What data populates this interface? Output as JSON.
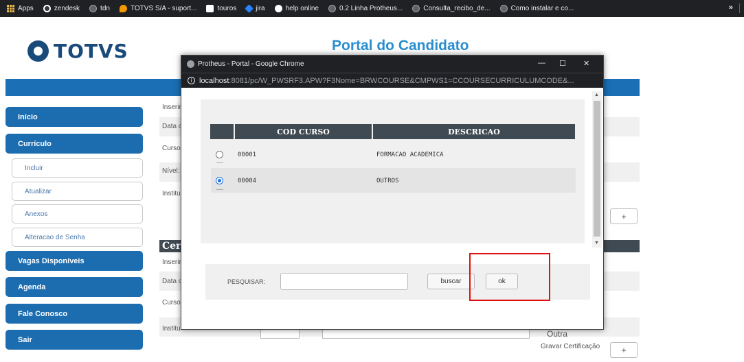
{
  "bookmarks": {
    "items": [
      "Apps",
      "zendesk",
      "tdn",
      "TOTVS S/A - suport...",
      "touros",
      "jira",
      "help online",
      "0.2 Linha Protheus...",
      "Consulta_recibo_de...",
      "Como instalar e co..."
    ],
    "more": "»"
  },
  "header": {
    "logo": "TOTVS",
    "title": "Portal do Candidato"
  },
  "sidebar": {
    "items": [
      "Início",
      "Currículo",
      "Incluir",
      "Atualizar",
      "Anexos",
      "Alteracao de Senha",
      "Vagas Disponíveis",
      "Agenda",
      "Fale Conosco",
      "Sair"
    ]
  },
  "background_form": {
    "labels": [
      "Inserir",
      "Data d",
      "Curso",
      "Nível:",
      "Institu",
      "Inserir",
      "Data d",
      "Curso",
      "Institu"
    ],
    "section": "Cer",
    "plus": "+",
    "outra": "Outra",
    "gravar": "Gravar Certificação"
  },
  "popup": {
    "title": "Protheus - Portal - Google Chrome",
    "url_host": "localhost",
    "url_rest": ":8081/pc/W_PWSRF3.APW?F3Nome=BRWCOURSE&CMPWS1=CCOURSECURRICULUMCODE&...",
    "controls": {
      "minimize": "—",
      "maximize": "☐",
      "close": "✕"
    },
    "grid": {
      "columns": [
        "COD CURSO",
        "DESCRICAO"
      ],
      "rows": [
        {
          "code": "00001",
          "desc": "FORMACAO ACADEMICA",
          "selected": false
        },
        {
          "code": "00004",
          "desc": "OUTROS",
          "selected": true
        }
      ]
    },
    "search": {
      "label": "PESQUISAR:",
      "value": "",
      "buscar": "buscar",
      "ok": "ok"
    }
  },
  "colors": {
    "brand_blue": "#1c6cb0",
    "title_blue": "#2a8fd0",
    "grid_header": "#404a52",
    "highlight_red": "#e01010"
  }
}
